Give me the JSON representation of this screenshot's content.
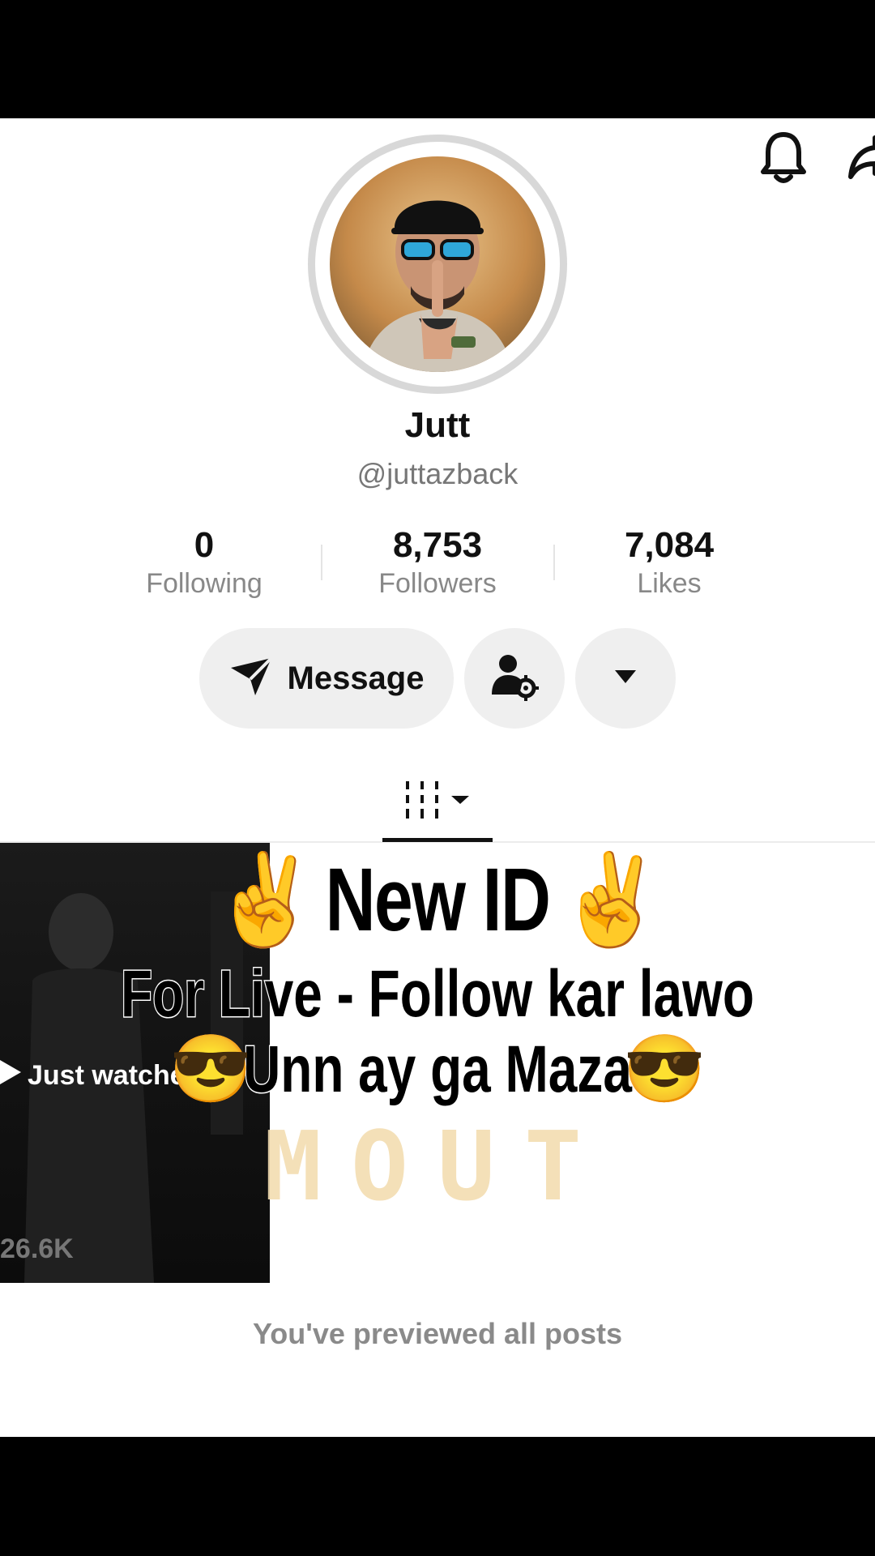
{
  "profile": {
    "name": "Jutt",
    "handle": "@juttazback"
  },
  "stats": [
    {
      "value": "0",
      "label": "Following"
    },
    {
      "value": "8,753",
      "label": "Followers"
    },
    {
      "value": "7,084",
      "label": "Likes"
    }
  ],
  "actions": {
    "message_label": "Message"
  },
  "icons": {
    "notifications": "bell-icon",
    "share": "share-icon",
    "message": "send-icon",
    "friends": "user-settings-icon",
    "more": "dropdown-icon",
    "grid_tab": "grid-icon"
  },
  "post": {
    "watched_label": "Just watched",
    "views": "26.6K"
  },
  "overlay": {
    "line1_emoji_left": "✌️",
    "line1_text": "New ID",
    "line1_emoji_right": "✌️",
    "line2": "For Live - Follow kar lawo",
    "line3_emoji_left": "😎",
    "line3_text": "Unn ay ga Maza",
    "line3_emoji_right": "😎",
    "watermark": "MOUT"
  },
  "footer": {
    "note": "You've previewed all posts"
  }
}
